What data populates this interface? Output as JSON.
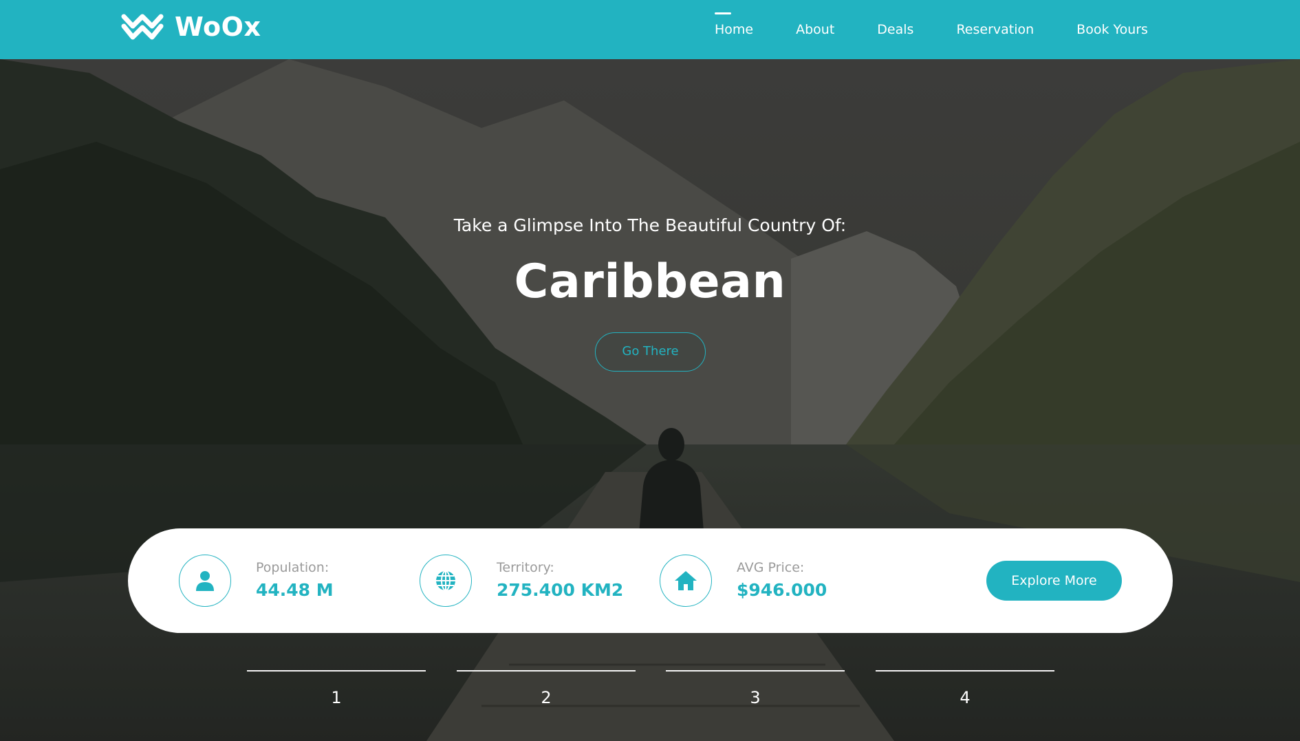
{
  "brand": {
    "name": "WoOx",
    "accent_color": "#22b3c1"
  },
  "nav": {
    "items": [
      {
        "label": "Home",
        "active": true
      },
      {
        "label": "About"
      },
      {
        "label": "Deals"
      },
      {
        "label": "Reservation"
      },
      {
        "label": "Book Yours"
      }
    ]
  },
  "hero": {
    "subtitle": "Take a Glimpse Into The Beautiful Country Of:",
    "title": "Caribbean",
    "button_label": "Go There"
  },
  "stats": {
    "items": [
      {
        "icon": "user-icon",
        "label": "Population:",
        "value": "44.48 M"
      },
      {
        "icon": "globe-icon",
        "label": "Territory:",
        "value": "275.400 KM2"
      },
      {
        "icon": "home-icon",
        "label": "AVG Price:",
        "value": "$946.000"
      }
    ],
    "button_label": "Explore More"
  },
  "slides": {
    "tabs": [
      "1",
      "2",
      "3",
      "4"
    ]
  }
}
